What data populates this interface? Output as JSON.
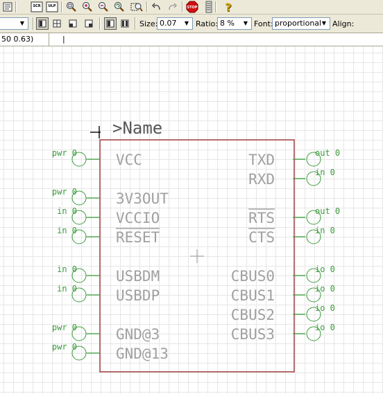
{
  "toolbar": {
    "icons": [
      "script-icon",
      "scr-icon",
      "ulp-icon",
      "zoom-fit-icon",
      "zoom-in-icon",
      "zoom-out-icon",
      "zoom-redraw-icon",
      "zoom-select-icon",
      "undo-icon",
      "redo-icon",
      "stop-icon",
      "go-icon",
      "help-icon"
    ],
    "scr_label": "SCR",
    "ulp_label": "ULP",
    "stop_label": "STOP",
    "help_label": "?"
  },
  "text_toolbar": {
    "size_label": "Size:",
    "size_value": "0.07",
    "ratio_label": "Ratio:",
    "ratio_value": "8 %",
    "font_label": "Font:",
    "font_value": "proportional",
    "align_label": "Align:"
  },
  "coords": "50 0.63)",
  "command_value": "|",
  "symbol": {
    "name_label": ">Name",
    "left_pins": [
      {
        "dir": "pwr",
        "swap": "0",
        "name": "VCC",
        "overline": false
      },
      {
        "dir": "pwr",
        "swap": "0",
        "name": "3V3OUT",
        "overline": false
      },
      {
        "dir": "in",
        "swap": "0",
        "name": "VCCIO",
        "overline": false
      },
      {
        "dir": "in",
        "swap": "0",
        "name": "RESET",
        "overline": true
      },
      {
        "dir": "in",
        "swap": "0",
        "name": "USBDM",
        "overline": false
      },
      {
        "dir": "in",
        "swap": "0",
        "name": "USBDP",
        "overline": false
      },
      {
        "dir": "pwr",
        "swap": "0",
        "name": "GND@3",
        "overline": false
      },
      {
        "dir": "pwr",
        "swap": "0",
        "name": "GND@13",
        "overline": false
      }
    ],
    "right_pins": [
      {
        "dir": "out",
        "swap": "0",
        "name": "TXD",
        "overline": false
      },
      {
        "dir": "in",
        "swap": "0",
        "name": "RXD",
        "overline": false
      },
      {
        "dir": "out",
        "swap": "0",
        "name": "RTS",
        "overline": true
      },
      {
        "dir": "in",
        "swap": "0",
        "name": "CTS",
        "overline": true
      },
      {
        "dir": "io",
        "swap": "0",
        "name": "CBUS0",
        "overline": false
      },
      {
        "dir": "io",
        "swap": "0",
        "name": "CBUS1",
        "overline": false
      },
      {
        "dir": "io",
        "swap": "0",
        "name": "CBUS2",
        "overline": false
      },
      {
        "dir": "io",
        "swap": "0",
        "name": "CBUS3",
        "overline": false
      }
    ]
  },
  "colors": {
    "pin": "#3a9a3a",
    "pin_name": "#a0a0a0",
    "outline": "#a04040",
    "grid": "#e6e6e6",
    "toolbar": "#ece9d8"
  }
}
